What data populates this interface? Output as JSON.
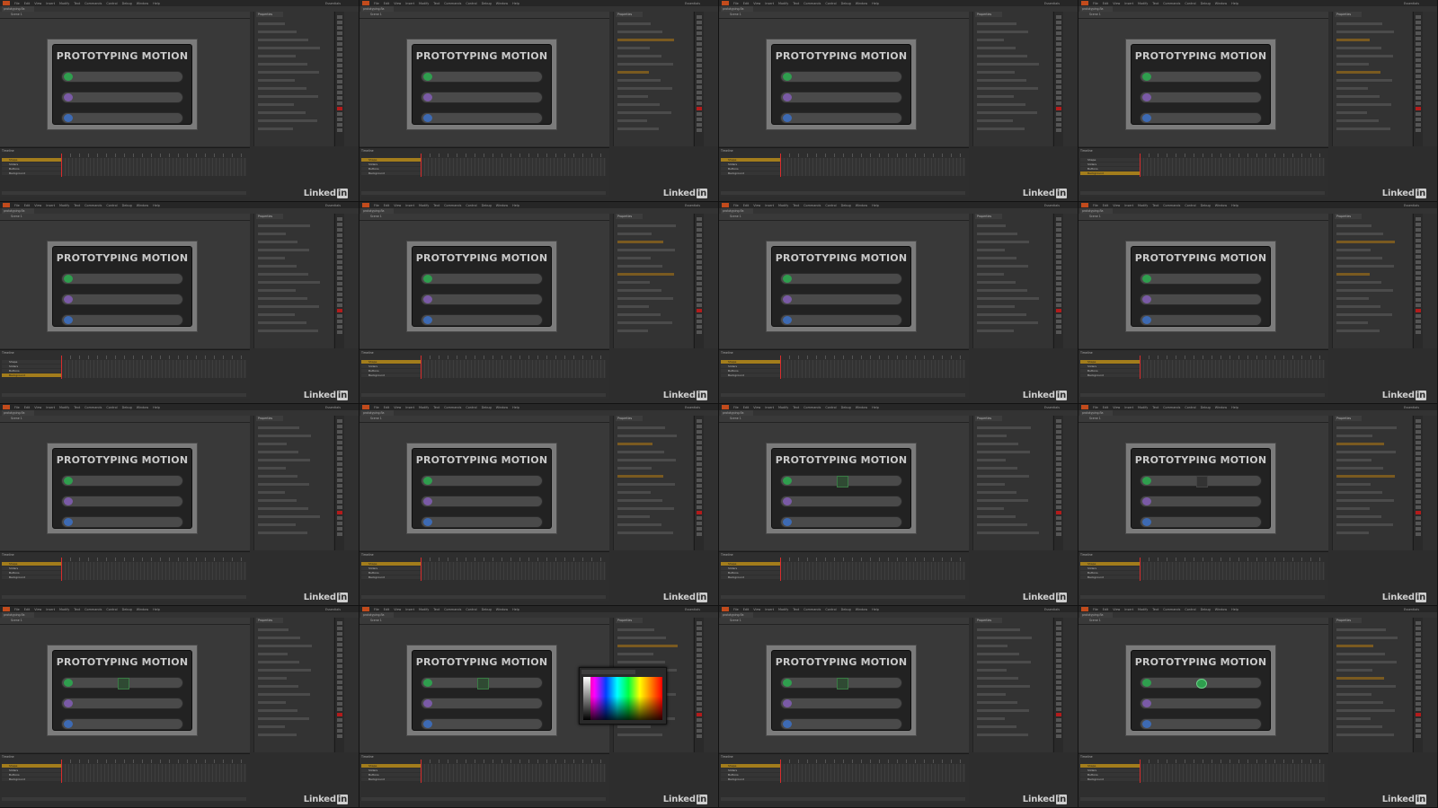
{
  "app": {
    "menu": [
      "File",
      "Edit",
      "View",
      "Insert",
      "Modify",
      "Text",
      "Commands",
      "Control",
      "Debug",
      "Window",
      "Help"
    ],
    "workspace": "Essentials",
    "document_tab": "prototyping.fla",
    "scene_label": "Scene 1",
    "properties_tab": "Properties",
    "timeline_tab": "Timeline",
    "layers": [
      "Shape",
      "Sliders",
      "Buttons",
      "Background"
    ],
    "brand_text": "Linked",
    "brand_in": "in"
  },
  "stage": {
    "title": "PROTOTYPING MOTION",
    "rows": [
      {
        "name": "track-green",
        "knob_color": "#2f9e4e"
      },
      {
        "name": "track-purple",
        "knob_color": "#7a5aa6"
      },
      {
        "name": "track-blue",
        "knob_color": "#3d6ab3"
      }
    ]
  },
  "colors": {
    "menubar": "#262626",
    "stage_bg": "#393939",
    "card_bg": "#222222",
    "layer_selected": "#a37d1c",
    "playhead": "#d82d2d"
  },
  "frames": [
    {
      "selected_layer": 0
    },
    {
      "selected_layer": 0
    },
    {
      "selected_layer": 0
    },
    {
      "selected_layer": 3
    },
    {
      "selected_layer": 3
    },
    {
      "selected_layer": 0
    },
    {
      "selected_layer": 0
    },
    {
      "selected_layer": 0
    },
    {
      "selected_layer": 0,
      "picker": false
    },
    {
      "selected_layer": 0
    },
    {
      "selected_layer": 0,
      "highlight": "rect-mid"
    },
    {
      "selected_layer": 0,
      "highlight": "rect-dark"
    },
    {
      "selected_layer": 0,
      "highlight": "rect-mid"
    },
    {
      "selected_layer": 0,
      "highlight": "rect-mid",
      "picker": true
    },
    {
      "selected_layer": 0,
      "highlight": "rect-mid"
    },
    {
      "selected_layer": 0,
      "highlight": "circle"
    }
  ]
}
